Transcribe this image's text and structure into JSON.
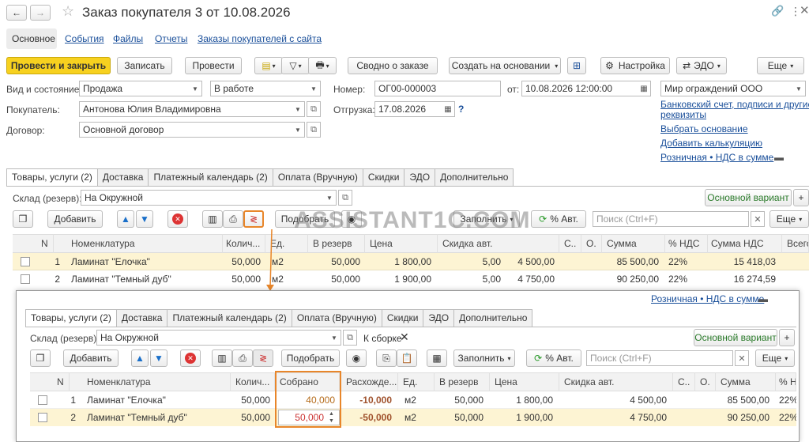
{
  "window": {
    "title": "Заказ покупателя 3 от 10.08.2026"
  },
  "navlinks": [
    "Основное",
    "События",
    "Файлы",
    "Отчеты",
    "Заказы покупателей с сайта"
  ],
  "toolbar": {
    "post_close": "Провести и закрыть",
    "save": "Записать",
    "post": "Провести",
    "summary": "Сводно о заказе",
    "create_based": "Создать на основании",
    "settings": "Настройка",
    "edo": "ЭДО",
    "more": "Еще"
  },
  "form": {
    "status_label": "Вид и состояние:",
    "status_type": "Продажа",
    "status_state": "В работе",
    "number_label": "Номер:",
    "number": "ОГ00-000003",
    "from_label": "от:",
    "date": "10.08.2026 12:00:00",
    "company": "Мир ограждений ООО",
    "buyer_label": "Покупатель:",
    "buyer": "Антонова Юлия Владимировна",
    "shipment_label": "Отгрузка:",
    "shipment": "17.08.2026",
    "help": "?",
    "contract_label": "Договор:",
    "contract": "Основной договор"
  },
  "side_links": [
    "Банковский счет, подписи и другие",
    "реквизиты",
    "Выбрать основание",
    "Добавить калькуляцию",
    "Розничная • НДС в сумме"
  ],
  "tabs": [
    "Товары, услуги (2)",
    "Доставка",
    "Платежный календарь (2)",
    "Оплата (Вручную)",
    "Скидки",
    "ЭДО",
    "Дополнительно"
  ],
  "warehouse": {
    "label": "Склад (резерв):",
    "value": "На Окружной",
    "variant": "Основной вариант",
    "plus": "+",
    "assembly": "К сборке"
  },
  "table_toolbar": {
    "add": "Добавить",
    "select": "Подобрать",
    "fill": "Заполнить",
    "auto": "% Авт.",
    "search_placeholder": "Поиск (Ctrl+F)",
    "more": "Еще"
  },
  "watermark": "ASSISTANT1C.COM",
  "top_table": {
    "headers": [
      "N",
      "Номенклатура",
      "Колич...",
      "Ед.",
      "В резерв",
      "Цена",
      "Скидка авт.",
      "С..",
      "О.",
      "Сумма",
      "% НДС",
      "Сумма НДС",
      "Всего"
    ],
    "rows": [
      [
        "1",
        "Ламинат \"Елочка\"",
        "50,000",
        "м2",
        "50,000",
        "1 800,00",
        "5,00",
        "4 500,00",
        "",
        "",
        "85 500,00",
        "22%",
        "15 418,03"
      ],
      [
        "2",
        "Ламинат \"Темный дуб\"",
        "50,000",
        "м2",
        "50,000",
        "1 900,00",
        "5,00",
        "4 750,00",
        "",
        "",
        "90 250,00",
        "22%",
        "16 274,59"
      ]
    ]
  },
  "bottom_table": {
    "headers": [
      "N",
      "Номенклатура",
      "Колич...",
      "Собрано",
      "Расхожде...",
      "Ед.",
      "В резерв",
      "Цена",
      "Скидка авт.",
      "С..",
      "О.",
      "Сумма",
      "% Н"
    ],
    "rows": [
      [
        "1",
        "Ламинат \"Елочка\"",
        "50,000",
        "40,000",
        "-10,000",
        "м2",
        "50,000",
        "1 800,00",
        "4 500,00",
        "",
        "",
        "85 500,00",
        "22%"
      ],
      [
        "2",
        "Ламинат \"Темный дуб\"",
        "50,000",
        "50,000",
        "-50,000",
        "м2",
        "50,000",
        "1 900,00",
        "4 750,00",
        "",
        "",
        "90 250,00",
        "22%"
      ]
    ]
  },
  "colors": {
    "accent": "#f7d11f",
    "highlight": "#fdf4d3",
    "orange": "#e8862a",
    "link": "#1a4f9a",
    "negative": "#a0522d"
  }
}
